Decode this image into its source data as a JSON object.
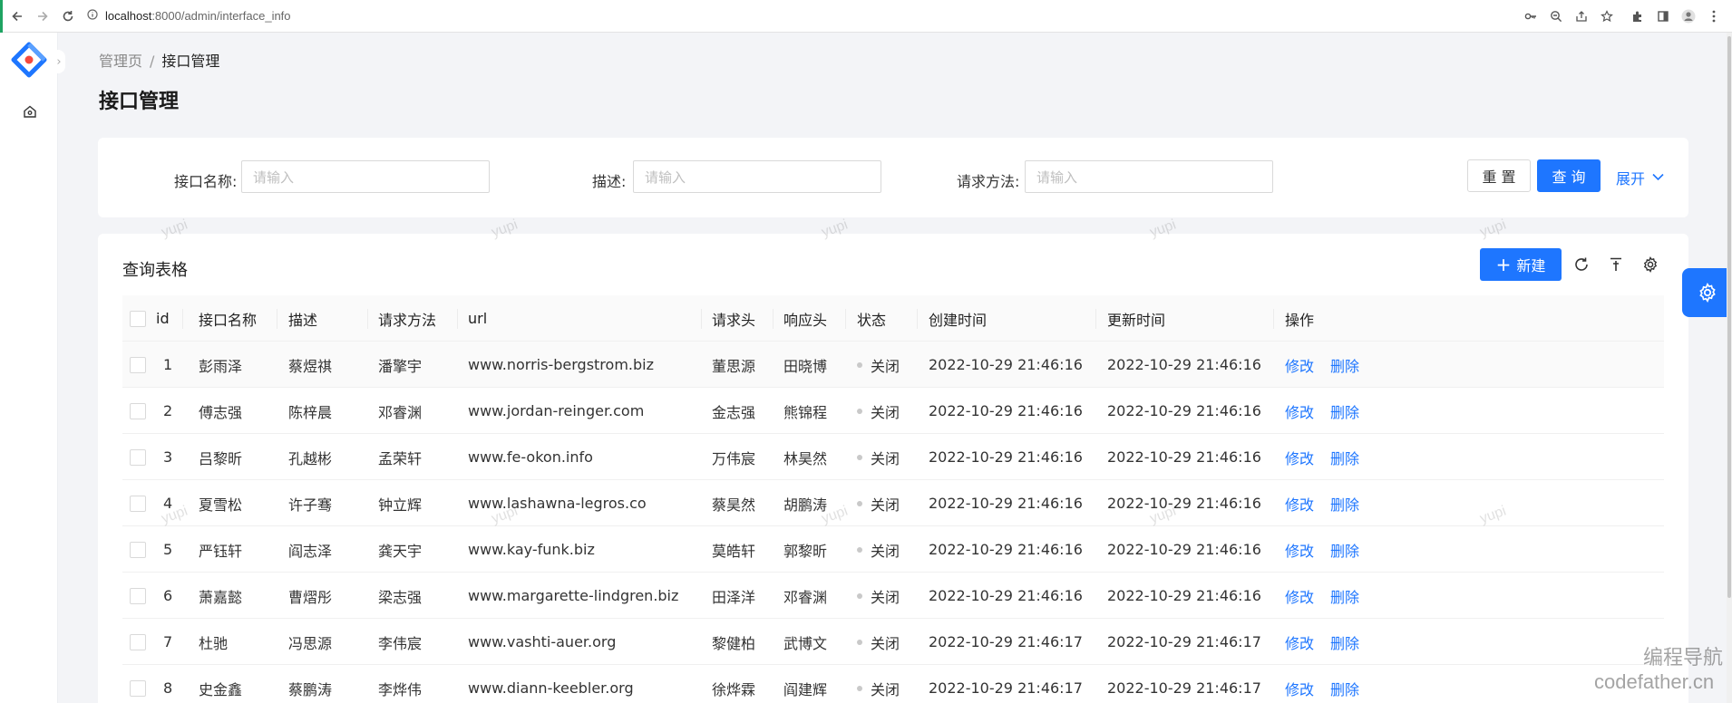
{
  "browser": {
    "url_host": "localhost",
    "url_rest": ":8000/admin/interface_info"
  },
  "breadcrumb": {
    "root": "管理页",
    "separator": "/",
    "current": "接口管理"
  },
  "page_title": "接口管理",
  "search": {
    "fields": [
      {
        "label": "接口名称:",
        "placeholder": "请输入"
      },
      {
        "label": "描述:",
        "placeholder": "请输入"
      },
      {
        "label": "请求方法:",
        "placeholder": "请输入"
      }
    ],
    "reset_label": "重 置",
    "query_label": "查 询",
    "expand_label": "展开"
  },
  "table": {
    "title": "查询表格",
    "new_label": "新建",
    "columns": [
      "id",
      "接口名称",
      "描述",
      "请求方法",
      "url",
      "请求头",
      "响应头",
      "状态",
      "创建时间",
      "更新时间",
      "操作"
    ],
    "rows": [
      {
        "id": "1",
        "name": "彭雨泽",
        "desc": "蔡煜祺",
        "method": "潘擎宇",
        "url": "www.norris-bergstrom.biz",
        "req_header": "董思源",
        "res_header": "田晓博",
        "status": "关闭",
        "created": "2022-10-29 21:46:16",
        "updated": "2022-10-29 21:46:16"
      },
      {
        "id": "2",
        "name": "傅志强",
        "desc": "陈梓晨",
        "method": "邓睿渊",
        "url": "www.jordan-reinger.com",
        "req_header": "金志强",
        "res_header": "熊锦程",
        "status": "关闭",
        "created": "2022-10-29 21:46:16",
        "updated": "2022-10-29 21:46:16"
      },
      {
        "id": "3",
        "name": "吕黎昕",
        "desc": "孔越彬",
        "method": "孟荣轩",
        "url": "www.fe-okon.info",
        "req_header": "万伟宸",
        "res_header": "林昊然",
        "status": "关闭",
        "created": "2022-10-29 21:46:16",
        "updated": "2022-10-29 21:46:16"
      },
      {
        "id": "4",
        "name": "夏雪松",
        "desc": "许子骞",
        "method": "钟立辉",
        "url": "www.lashawna-legros.co",
        "req_header": "蔡昊然",
        "res_header": "胡鹏涛",
        "status": "关闭",
        "created": "2022-10-29 21:46:16",
        "updated": "2022-10-29 21:46:16"
      },
      {
        "id": "5",
        "name": "严钰轩",
        "desc": "阎志泽",
        "method": "龚天宇",
        "url": "www.kay-funk.biz",
        "req_header": "莫皓轩",
        "res_header": "郭黎昕",
        "status": "关闭",
        "created": "2022-10-29 21:46:16",
        "updated": "2022-10-29 21:46:16"
      },
      {
        "id": "6",
        "name": "萧嘉懿",
        "desc": "曹熠彤",
        "method": "梁志强",
        "url": "www.margarette-lindgren.biz",
        "req_header": "田泽洋",
        "res_header": "邓睿渊",
        "status": "关闭",
        "created": "2022-10-29 21:46:16",
        "updated": "2022-10-29 21:46:16"
      },
      {
        "id": "7",
        "name": "杜驰",
        "desc": "冯思源",
        "method": "李伟宸",
        "url": "www.vashti-auer.org",
        "req_header": "黎健柏",
        "res_header": "武博文",
        "status": "关闭",
        "created": "2022-10-29 21:46:17",
        "updated": "2022-10-29 21:46:17"
      },
      {
        "id": "8",
        "name": "史金鑫",
        "desc": "蔡鹏涛",
        "method": "李烨伟",
        "url": "www.diann-keebler.org",
        "req_header": "徐烨霖",
        "res_header": "阎建辉",
        "status": "关闭",
        "created": "2022-10-29 21:46:17",
        "updated": "2022-10-29 21:46:17"
      }
    ],
    "edit_label": "修改",
    "delete_label": "删除"
  },
  "watermark": "yupi",
  "corner_watermark": {
    "line1": "编程导航",
    "line2": "codefather.cn"
  },
  "colors": {
    "primary": "#1e76ff",
    "status_dot": "#c9c9c9"
  },
  "icons": {
    "back": "back-arrow-icon",
    "forward": "forward-arrow-icon",
    "reload": "reload-icon",
    "home": "home-icon",
    "refresh": "refresh-icon",
    "density": "density-icon",
    "settings": "settings-icon"
  }
}
